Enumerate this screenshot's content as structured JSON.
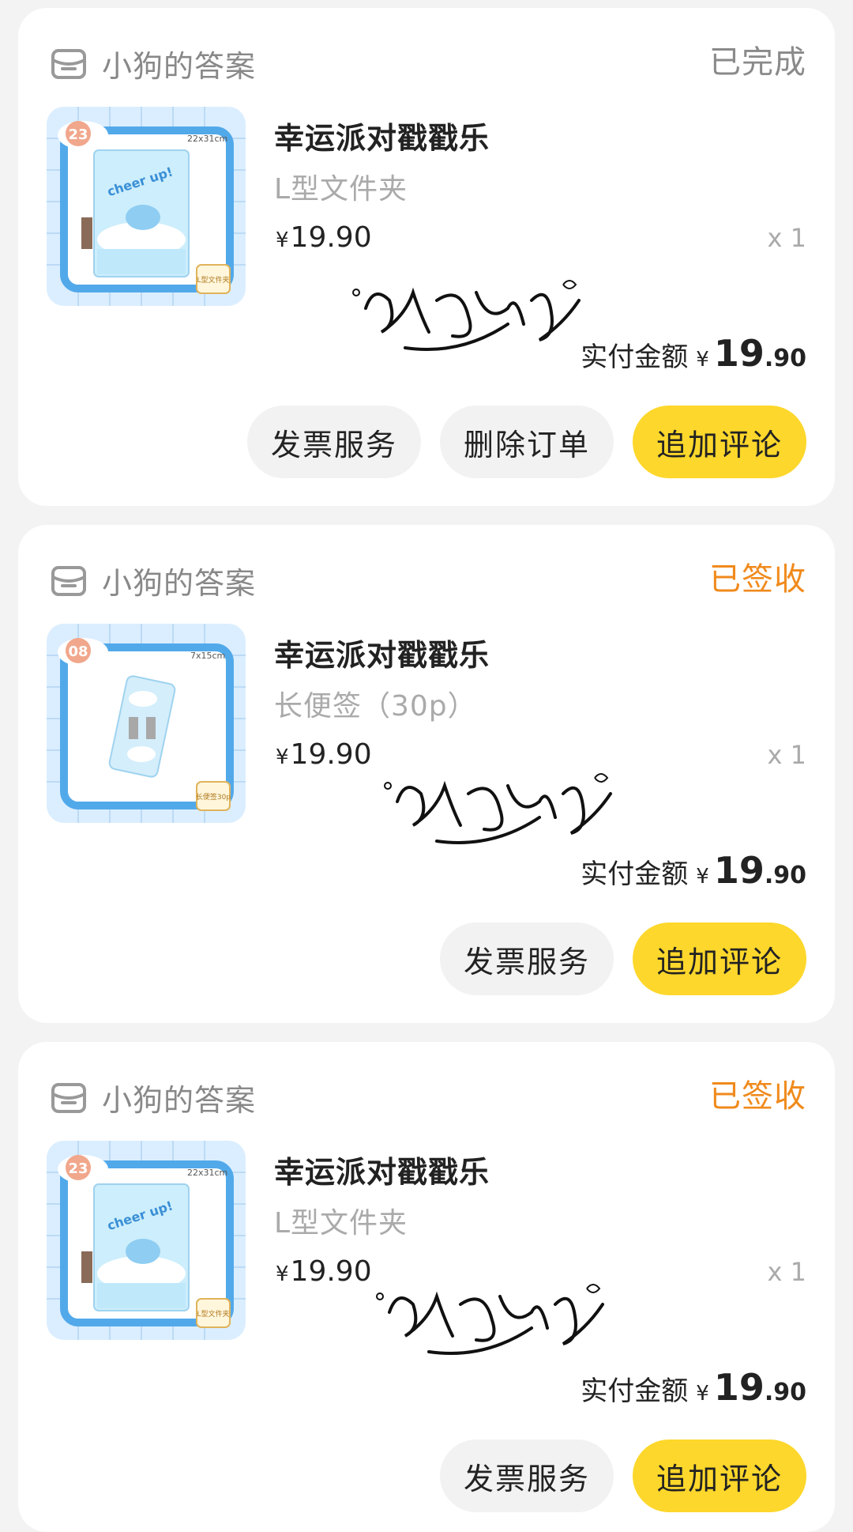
{
  "orders": [
    {
      "shop": "小狗的答案",
      "status": "已完成",
      "status_color": "#8a8a8a",
      "title": "幸运派对戳戳乐",
      "spec": "L型文件夹",
      "price": "19.90",
      "currency": "¥",
      "qty": "x 1",
      "paid_label": "实付金额",
      "paid_int": "19",
      "paid_dec": ".90",
      "watermark": "酱香鱼仔",
      "buttons": [
        "发票服务",
        "删除订单",
        "追加评论"
      ]
    },
    {
      "shop": "小狗的答案",
      "status": "已签收",
      "status_color": "#f08a1c",
      "title": "幸运派对戳戳乐",
      "spec": "长便签（30p）",
      "price": "19.90",
      "currency": "¥",
      "qty": "x 1",
      "paid_label": "实付金额",
      "paid_int": "19",
      "paid_dec": ".90",
      "watermark": "酱香鱼仔",
      "buttons": [
        "发票服务",
        "追加评论"
      ]
    },
    {
      "shop": "小狗的答案",
      "status": "已签收",
      "status_color": "#f08a1c",
      "title": "幸运派对戳戳乐",
      "spec": "L型文件夹",
      "price": "19.90",
      "currency": "¥",
      "qty": "x 1",
      "paid_label": "实付金额",
      "paid_int": "19",
      "paid_dec": ".90",
      "watermark": "酱香鱼仔",
      "buttons": [
        "发票服务",
        "追加评论"
      ]
    }
  ],
  "thumbs": [
    {
      "badge": "23",
      "size_text": "22x31cm",
      "cover_text": "cheer up!",
      "tag": "L型文件夹"
    },
    {
      "badge": "08",
      "size_text": "7x15cm",
      "cover_text": "",
      "tag": "长便签30p"
    },
    {
      "badge": "23",
      "size_text": "22x31cm",
      "cover_text": "cheer up!",
      "tag": "L型文件夹"
    }
  ],
  "colors": {
    "accent_yellow": "#fdd72b",
    "signed_orange": "#f08a1c"
  },
  "icons": {
    "shop": "store-icon"
  }
}
